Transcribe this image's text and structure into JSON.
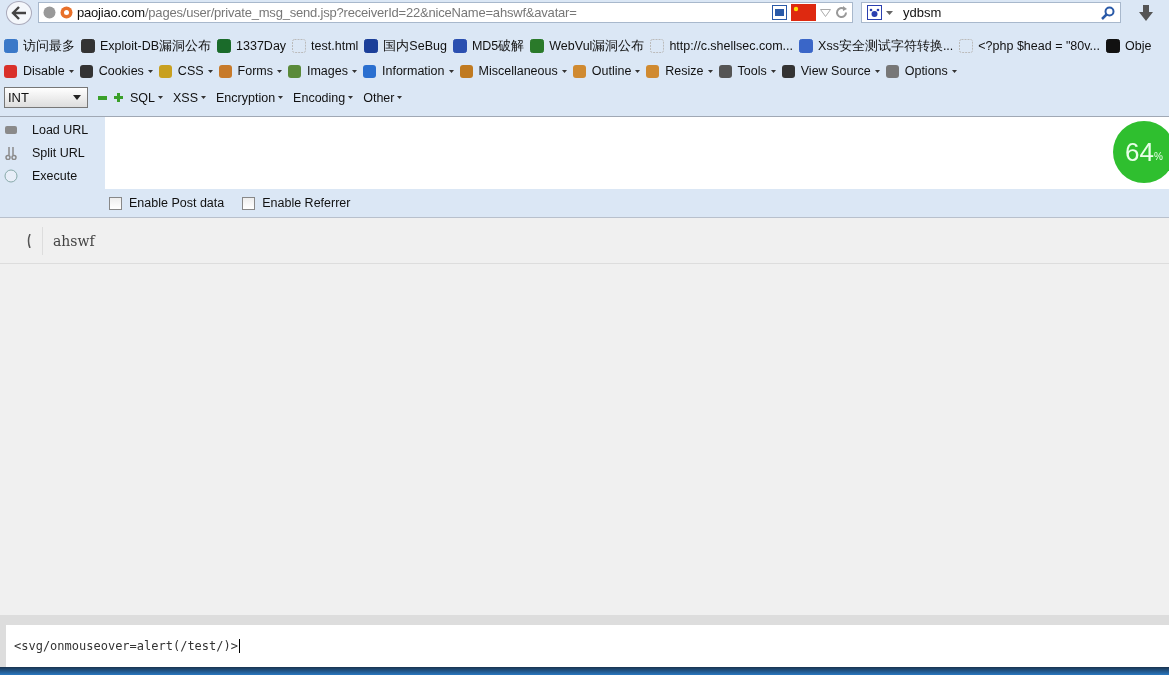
{
  "address_bar": {
    "domain": "paojiao.com",
    "path": "/pages/user/private_msg_send.jsp?receiverId=22&niceName=ahswf&avatar="
  },
  "search_bar": {
    "value": "ydbsm"
  },
  "bookmarks": [
    "访问最多",
    "Exploit-DB漏洞公布",
    "1337Day",
    "test.html",
    "国内SeBug",
    "MD5破解",
    "WebVul漏洞公布",
    "http://c.shellsec.com...",
    "Xss安全测试字符转换...",
    "<?php $head = \"80v...",
    "Obje"
  ],
  "webdev_menu": [
    "Disable",
    "Cookies",
    "CSS",
    "Forms",
    "Images",
    "Information",
    "Miscellaneous",
    "Outline",
    "Resize",
    "Tools",
    "View Source",
    "Options"
  ],
  "hackbar": {
    "type_select": "INT",
    "menus": [
      "SQL",
      "XSS",
      "Encryption",
      "Encoding",
      "Other"
    ],
    "actions": [
      "Load URL",
      "Split URL",
      "Execute"
    ],
    "options": [
      {
        "label": "Enable Post data",
        "checked": false
      },
      {
        "label": "Enable Referrer",
        "checked": false
      }
    ]
  },
  "speed_badge": {
    "value": "64",
    "unit": "%"
  },
  "page": {
    "recipient": "ahswf",
    "message": "<svg/onmouseover=alert(/test/)>"
  }
}
